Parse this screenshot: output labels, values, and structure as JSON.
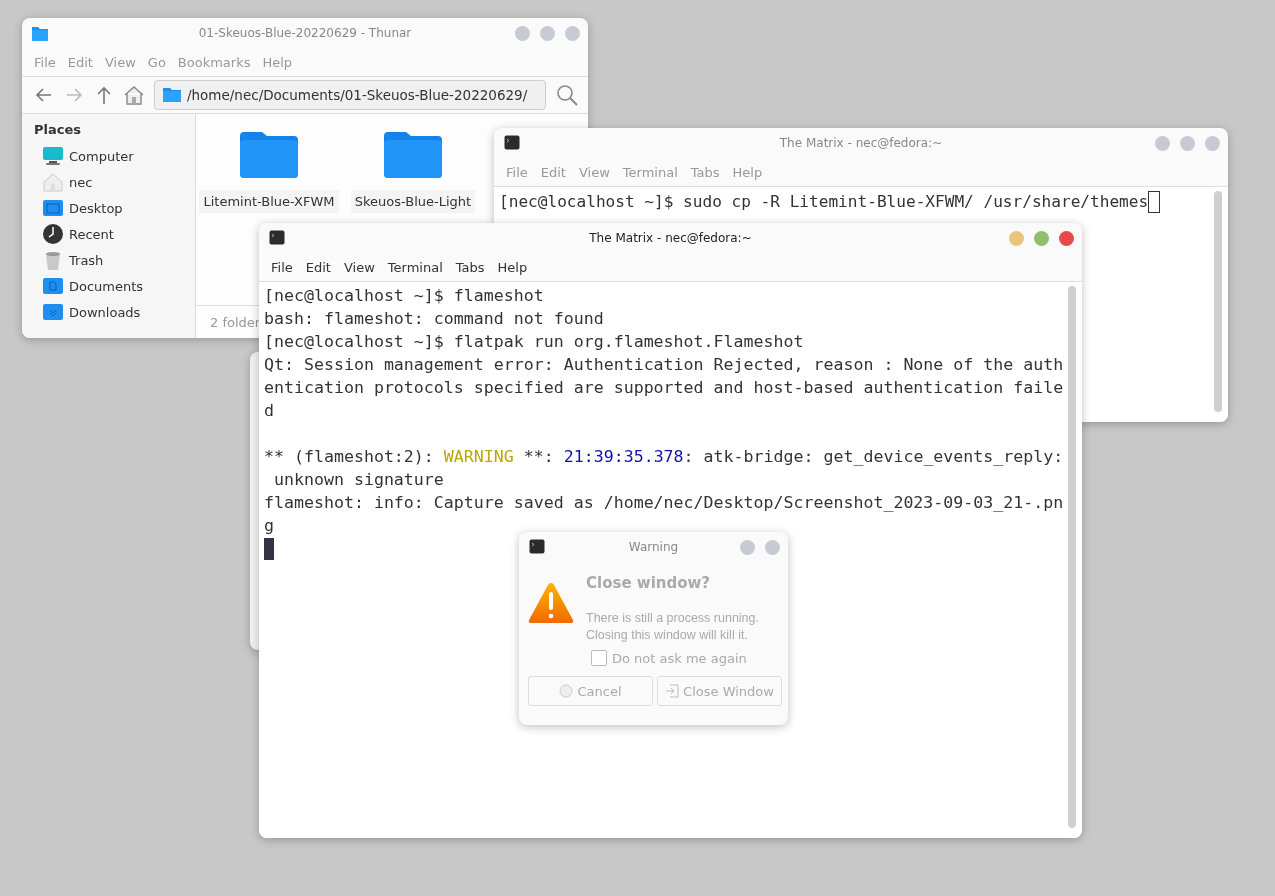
{
  "windows": [
    {
      "kind": "file-manager",
      "title": "01-Skeuos-Blue-20220629 - Thunar",
      "active": false,
      "menu": [
        "File",
        "Edit",
        "View",
        "Go",
        "Bookmarks",
        "Help"
      ],
      "location": "/home/nec/Documents/01-Skeuos-Blue-20220629/",
      "sidebar": {
        "heading": "Places",
        "items": [
          {
            "label": "Computer",
            "kind": "computer"
          },
          {
            "label": "nec",
            "kind": "home"
          },
          {
            "label": "Desktop",
            "kind": "desktop"
          },
          {
            "label": "Recent",
            "kind": "recent"
          },
          {
            "label": "Trash",
            "kind": "trash"
          },
          {
            "label": "Documents",
            "kind": "documents"
          },
          {
            "label": "Downloads",
            "kind": "downloads"
          }
        ]
      },
      "files": [
        {
          "name": "Litemint-Blue-XFWM"
        },
        {
          "name": "Skeuos-Blue-Light"
        }
      ],
      "status_bar": "2 folder"
    },
    {
      "kind": "terminal",
      "title": "The Matrix - nec@fedora:~",
      "active": false,
      "menu": [
        "File",
        "Edit",
        "View",
        "Terminal",
        "Tabs",
        "Help"
      ],
      "lines": [
        {
          "text": "[nec@localhost ~]$ sudo cp -R Litemint-Blue-XFWM/ /usr/share/themes",
          "cursor": true
        }
      ]
    },
    {
      "kind": "terminal",
      "title": "The Matrix - nec@fedora:~",
      "active": true,
      "menu": [
        "File",
        "Edit",
        "View",
        "Terminal",
        "Tabs",
        "Help"
      ],
      "lines": [
        {
          "text": "[nec@localhost ~]$ flameshot"
        },
        {
          "text": "bash: flameshot: command not found"
        },
        {
          "text": "[nec@localhost ~]$ flatpak run org.flameshot.Flameshot"
        },
        {
          "text": "Qt: Session management error: Authentication Rejected, reason : None of the auth"
        },
        {
          "text": "entication protocols specified are supported and host-based authentication faile"
        },
        {
          "text": "d",
          "blank_after": true
        },
        {
          "segments": [
            {
              "text": "** (flameshot:2): ",
              "kind": "plain"
            },
            {
              "text": "WARNING",
              "kind": "warning"
            },
            {
              "text": " **: ",
              "kind": "plain"
            },
            {
              "text": "21:39:35.378",
              "kind": "timestamp"
            },
            {
              "text": ": atk-bridge: get_device_events_reply:",
              "kind": "plain"
            }
          ]
        },
        {
          "text": " unknown signature"
        },
        {
          "text": "flameshot: info: Capture saved as /home/nec/Desktop/Screenshot_2023-09-03_21-.pn"
        },
        {
          "text": "g"
        },
        {
          "cursor": true
        }
      ]
    },
    {
      "kind": "dialog",
      "title": "Warning",
      "active": false,
      "heading": "Close window?",
      "message": "There is still a process running. Closing this window will kill it.",
      "checkbox": {
        "label": "Do not ask me again",
        "checked": false
      },
      "buttons": [
        {
          "label": "Cancel",
          "kind": "cancel"
        },
        {
          "label": "Close Window",
          "kind": "close"
        }
      ]
    }
  ]
}
